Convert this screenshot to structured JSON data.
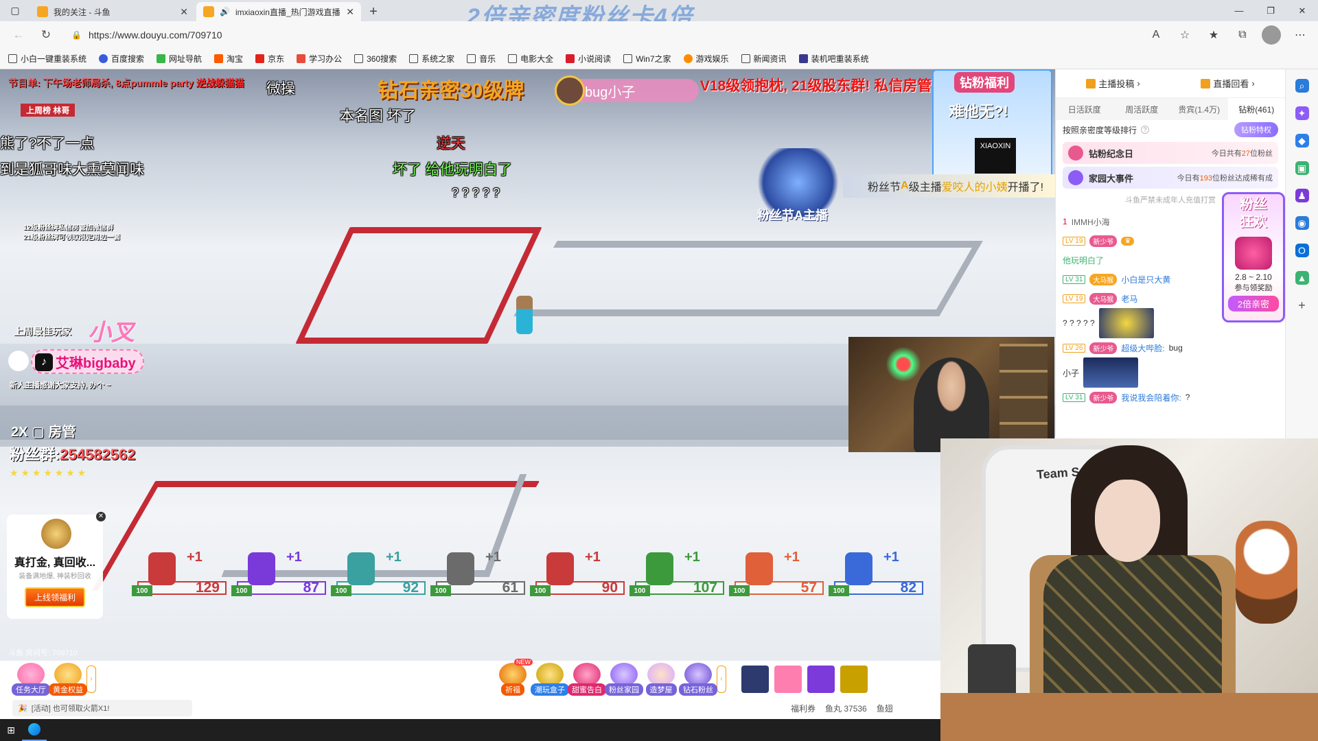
{
  "browser": {
    "tabs": [
      {
        "title": "我的关注 - 斗鱼",
        "active": false
      },
      {
        "title": "imxiaoxin直播_热门游戏直播",
        "active": true
      }
    ],
    "banner_overlay": "2倍亲密度粉丝卡4倍",
    "url": "https://www.douyu.com/709710",
    "bookmarks": [
      "小白一键重装系统",
      "百度搜索",
      "网址导航",
      "淘宝",
      "京东",
      "学习办公",
      "360搜索",
      "系统之家",
      "音乐",
      "电影大全",
      "小说阅读",
      "Win7之家",
      "游戏娱乐",
      "新闻资讯",
      "装机吧重装系统"
    ]
  },
  "stream": {
    "top_left_1": "节目单: 下午场老师局杀, 8点pummle party",
    "top_left_1b": "逆战躲猫猫",
    "top_left_2": "上周榜",
    "top_left_2b": "林哥",
    "header_main": "钻石亲密30级牌",
    "header_right": "V18级领抱枕, 21级股东群! 私信房管",
    "host_name": "bug小子",
    "promo_title": "钻粉福利",
    "promo_sub": "难他无?!",
    "promo_logo": "XIAOXIN",
    "fan_badge": "粉丝节A主播",
    "fan_ribbon": {
      "prefix": "粉丝节",
      "level": "A",
      "mid": "级主播",
      "name": "爱咬人的小姨",
      "suffix": "开播了!"
    },
    "notice_small_1": "12级粉丝牌私信房管加微信群",
    "notice_small_2": "21级粉丝牌可领取限定周边一套",
    "danmu": [
      {
        "text": "微操",
        "color": "#ffffff"
      },
      {
        "text": "本名图 坏了",
        "color": "#ffffff"
      },
      {
        "text": "熊了?不了一点",
        "color": "#ffffff"
      },
      {
        "text": "到是狐哥味大熏莫闻味",
        "color": "#ffffff"
      },
      {
        "text": "逆天",
        "color": "#ff3b3b"
      },
      {
        "text": "坏了 给他玩明白了",
        "color": "#7cff5c"
      },
      {
        "text": "? ? ? ? ?",
        "color": "#ffffff"
      }
    ],
    "last_week_label": "上周最佳玩家",
    "last_week_name": "小叉",
    "tiktok_name": "艾琳bigbaby",
    "thanks_line": "新人主播感谢大家支持, 办个 ~",
    "roles_1": "2X",
    "roles_2": "房管",
    "fan_group_label": "粉丝群:",
    "fan_group_num": "254582562",
    "gift_card": {
      "title": "真打金, 真回收...",
      "desc": "装备满地爆, 神装秒回收",
      "button": "上线领福利",
      "coin_text": "福利"
    },
    "scores": [
      {
        "value": "129",
        "hp": "100",
        "color": "#c93a3a",
        "plus": "+1"
      },
      {
        "value": "87",
        "hp": "100",
        "color": "#7a3ad9",
        "plus": "+1"
      },
      {
        "value": "92",
        "hp": "100",
        "color": "#3aa0a0",
        "plus": "+1"
      },
      {
        "value": "61",
        "hp": "100",
        "color": "#6b6b6b",
        "plus": "+1"
      },
      {
        "value": "90",
        "hp": "100",
        "color": "#c93a3a",
        "plus": "+1"
      },
      {
        "value": "107",
        "hp": "100",
        "color": "#3c9a3c",
        "plus": "+1"
      },
      {
        "value": "57",
        "hp": "100",
        "color": "#e0603a",
        "plus": "+1"
      },
      {
        "value": "82",
        "hp": "100",
        "color": "#3a6ad9",
        "plus": "+1"
      }
    ],
    "watermark": "斗鱼 房间号: 709710"
  },
  "toolbar": {
    "left_items": [
      "任务大厅",
      "黄金权益"
    ],
    "mid_items": [
      {
        "label": "祈福",
        "new": true
      },
      {
        "label": "潮玩盒子",
        "new": false
      },
      {
        "label": "甜蜜告白",
        "new": false
      },
      {
        "label": "粉丝家园",
        "new": false
      },
      {
        "label": "造梦屋",
        "new": false
      },
      {
        "label": "钻石粉丝",
        "new": false
      }
    ],
    "msg": "[活动] 也可领取火箭X1!",
    "right_items": [
      "福利券",
      "鱼丸 37536",
      "鱼翅"
    ]
  },
  "chat_panel": {
    "top_items": [
      "主播投稿",
      "直播回看"
    ],
    "tabs": [
      {
        "label": "日活跃度",
        "active": false
      },
      {
        "label": "周活跃度",
        "active": false
      },
      {
        "label": "贵宾(1.4万)",
        "active": false
      },
      {
        "label": "钻粉(461)",
        "active": true
      }
    ],
    "sort_label": "按照亲密度等级排行",
    "vip_label": "钻粉特权",
    "card1": {
      "title": "钻粉纪念日",
      "sub_prefix": "今日共有",
      "sub_num": "27",
      "sub_suffix": "位粉丝"
    },
    "card2": {
      "title": "家园大事件",
      "sub_prefix": "今日有",
      "sub_num": "193",
      "sub_suffix": "位粉丝达成稀有成"
    },
    "notice": "斗鱼严禁未成年人充值打赏",
    "rank_line": {
      "rank": "1",
      "name": "IMMH小海"
    },
    "messages": [
      {
        "lv": "LV 19",
        "badge": "新少爷",
        "name": "",
        "text": ""
      },
      {
        "lv": "",
        "badge": "",
        "name": "",
        "text": "他玩明白了"
      },
      {
        "lv": "LV 31",
        "badge": "大马猴",
        "name": "小白是只大黄",
        "text": ""
      },
      {
        "lv": "LV 19",
        "badge": "大马猴",
        "name": "老马",
        "text": ""
      },
      {
        "lv": "",
        "badge": "",
        "name": "",
        "text": "? ? ? ? ?"
      },
      {
        "lv": "LV 26",
        "badge": "新少爷",
        "name": "超级大哔脸:",
        "text": "bug"
      },
      {
        "lv": "",
        "badge": "",
        "name": "",
        "text": "小子"
      },
      {
        "lv": "LV 31",
        "badge": "新少爷",
        "name": "我说我会陪着你:",
        "text": "?"
      }
    ],
    "fan_float": {
      "title1": "粉丝",
      "title2": "狂欢",
      "date": "2.8 ~ 2.10",
      "act": "参与领奖励",
      "btn": "2倍亲密"
    }
  },
  "cam2": {
    "chair_text": "Team Sea"
  }
}
